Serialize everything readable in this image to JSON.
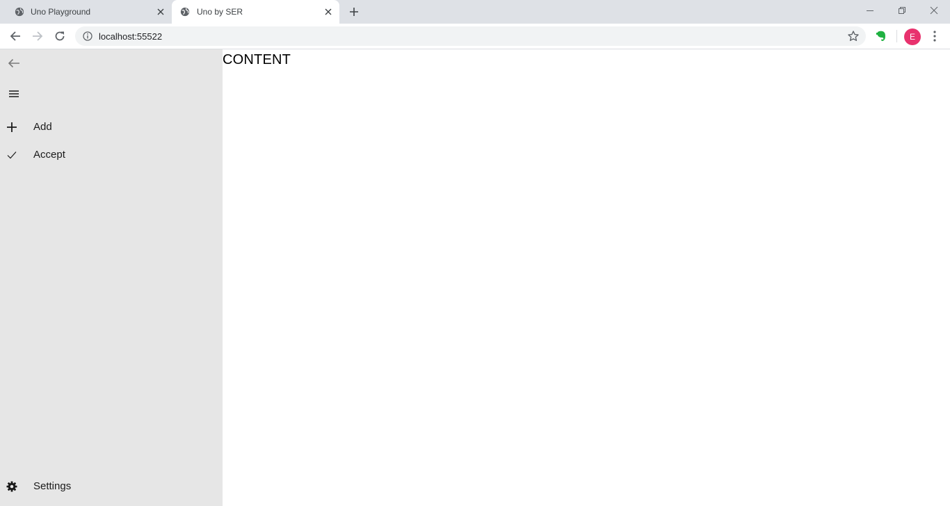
{
  "browser": {
    "tabs": [
      {
        "title": "Uno Playground",
        "icon": "globe-icon",
        "active": false
      },
      {
        "title": "Uno by SER",
        "icon": "globe-icon",
        "active": true
      }
    ],
    "url": "localhost:55522",
    "profile_initial": "E",
    "profile_color": "#e8326e"
  },
  "app": {
    "nav_items": [
      {
        "label": "Add",
        "icon": "plus-icon"
      },
      {
        "label": "Accept",
        "icon": "checkmark-icon"
      }
    ],
    "settings_label": "Settings",
    "content_text": "CONTENT",
    "pane_color": "#e6e6e6"
  }
}
